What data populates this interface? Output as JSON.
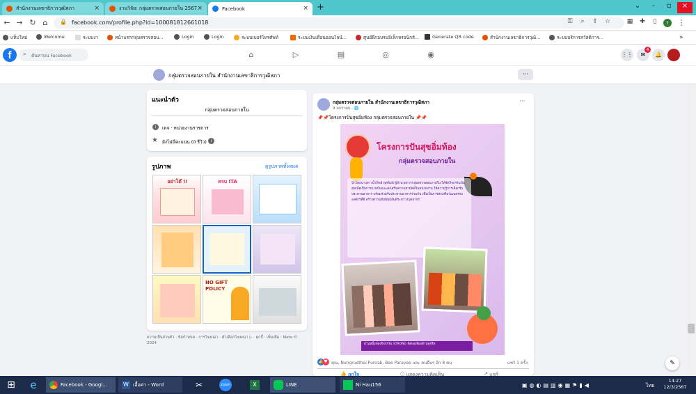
{
  "browser": {
    "tabs": [
      {
        "title": "สำนักงานเลขาธิการวุฒิสภา",
        "active": false
      },
      {
        "title": "งานวิจัย: กลุ่มตรวจสอบภายใน 2567",
        "active": false
      },
      {
        "title": "Facebook",
        "active": true
      }
    ],
    "new_tab": "+",
    "url": "facebook.com/profile.php?id=100081812661018",
    "bookmarks": [
      "แท็บใหม่",
      "Welcome",
      "ระบบงา",
      "หน้าแรกกลุ่มตรวจสอบ...",
      "Login",
      "Login",
      "ระบบเบอร์โทรศัพท์",
      "ระบบเงินเดือนออนไลน์...",
      "ศูนย์ฝึกอบรมอิเล็กทรอนิกส์...",
      "Generate QR code",
      "สำนักงานเลขาธิการวุฒิ...",
      "ระบบบริการสวัสดิการ..."
    ]
  },
  "fb": {
    "logo": "f",
    "search_placeholder": "ค้นหาบน Facebook",
    "notif_count": "4"
  },
  "page_bar": {
    "name": "กลุ่มตรวจสอบภายใน สำนักงานเลขาธิการวุฒิสภา",
    "more": "···"
  },
  "intro": {
    "title": "แนะนำตัว",
    "subtitle": "กลุ่มตรวจสอบภายใน",
    "category": "เพจ · หน่วยงานราชการ",
    "rating": "ยังไม่มีคะแนน (0 รีวิว)"
  },
  "photos": {
    "title": "รูปภาพ",
    "see_all": "ดูรูปภาพทั้งหมด",
    "thumb_labels": [
      "อย่าโต๊ !!",
      "ครบ ITA",
      "",
      "",
      "",
      "",
      "",
      "NO GIFT POLICY",
      ""
    ]
  },
  "footer": {
    "links": "ความเป็นส่วนตัว · ข้อกำหนด · การโฆษณา · ตัวเลือกโฆษณา ▷ · คุกกี้ · เพิ่มเติม · Meta © 2024"
  },
  "post": {
    "author": "กลุ่มตรวจสอบภายใน สำนักงานเลขาธิการวุฒิสภา",
    "time": "9 มกราคม · 🌐",
    "text": "📌📌โครงการปันสุขอิ่มท้อง กลุ่มตรวจสอบภายใน 📌📌",
    "poster_title": "โครงการปันสุขอิ่มท้อง",
    "poster_sub": "กลุ่มตรวจสอบภายใน",
    "poster_body": "นำโดยนางสาวน้ำทิพย์ พุดพิมพ์ ผู้อำนวยการกลุ่มตรวจสอบภายใน ได้จัดกิจกรรมปันสุขเพื่อเป็นการแบ่งปันและส่งเสริมความสามัคคีในหน่วยงาน ให้ความรู้การเลือกรับประทานอาหาร พร้อมร่วมรับประทานอาหารร่วมกัน เพื่อเป็นการส่งเสริมวัฒนธรรมองค์กรที่ดี สร้างความสัมพันธ์อันดีระหว่างบุคลากร",
    "poster_footer": "ส่วนหนึ่งของกิจกรรม STRONG จิตพอเพียงต้านทุจริต",
    "reactions": "คุณ, Nungruethai Punrak, Bee Paravee และ คนอื่นๆ อีก 8 คน",
    "shares": "แชร์ 1 ครั้ง",
    "like": "ถูกใจ",
    "comment": "แสดงความคิดเห็น",
    "share": "แชร์"
  },
  "taskbar": {
    "items": [
      "Facebook - Googl...",
      "เอื้อศา - Word",
      "LINE",
      "Ni Hau156"
    ],
    "lang": "ไทย",
    "time": "14:27",
    "date": "12/3/2567"
  },
  "colors": {
    "accent": "#1877f2",
    "tabbar": "#4fc6cc",
    "poster_bg": "#e7c8f0",
    "poster_title": "#d4145a"
  }
}
